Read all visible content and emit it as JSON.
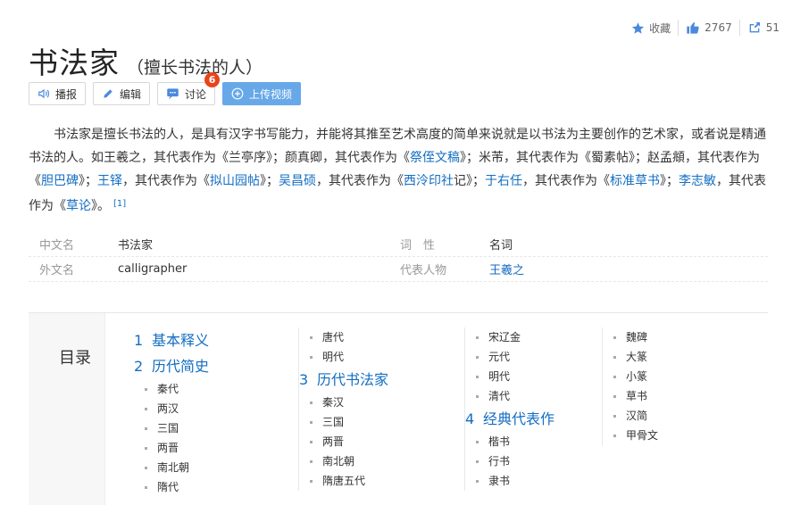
{
  "actions": {
    "favorite_label": "收藏",
    "like_count": "2767",
    "share_count": "51"
  },
  "title": {
    "main": "书法家",
    "sub": "（擅长书法的人）"
  },
  "toolbar": {
    "broadcast_label": "播报",
    "edit_label": "编辑",
    "discuss_label": "讨论",
    "discuss_badge": "6",
    "upload_label": "上传视频"
  },
  "summary": {
    "t1": "书法家是擅长书法的人，是具有汉字书写能力，并能将其推至艺术高度的简单来说就是以书法为主要创作的艺术家，或者说是精通书法的人。如王羲之，其代表作为《兰亭序》；颜真卿，其代表作为《",
    "a1": "祭侄文稿",
    "t2": "》；米芾，其代表作为《蜀素帖》；赵孟頫，其代表作为《",
    "a2": "胆巴碑",
    "t3": "》；",
    "a3": "王铎",
    "t4": "，其代表作为《",
    "a4": "拟山园帖",
    "t5": "》；",
    "a5": "吴昌硕",
    "t6": "，其代表作为《",
    "a6": "西泠印社",
    "t7": "记》；",
    "a7": "于右任",
    "t8": "，其代表作为《",
    "a8": "标准草书",
    "t9": "》；",
    "a9": "李志敏",
    "t10": "，其代表作为《",
    "a10": "草论",
    "t11": "》。",
    "ref": "[1]"
  },
  "infobox": {
    "rows": [
      {
        "k": "中文名",
        "v": "书法家",
        "k2": "词　性",
        "v2": "名词"
      },
      {
        "k": "外文名",
        "v": "calligrapher",
        "k2": "代表人物",
        "v2": "王羲之"
      }
    ]
  },
  "catalog": {
    "label": "目录",
    "col1": {
      "s1": {
        "num": "1",
        "label": "基本释义"
      },
      "s2": {
        "num": "2",
        "label": "历代简史"
      },
      "items": [
        "秦代",
        "两汉",
        "三国",
        "两晋",
        "南北朝",
        "隋代"
      ]
    },
    "col2": {
      "items_a": [
        "唐代",
        "明代"
      ],
      "s3": {
        "num": "3",
        "label": "历代书法家"
      },
      "items_b": [
        "秦汉",
        "三国",
        "两晋",
        "南北朝",
        "隋唐五代"
      ]
    },
    "col3": {
      "items_a": [
        "宋辽金",
        "元代",
        "明代",
        "清代"
      ],
      "s4": {
        "num": "4",
        "label": "经典代表作"
      },
      "items_b": [
        "楷书",
        "行书",
        "隶书"
      ]
    },
    "col4": {
      "items": [
        "魏碑",
        "大篆",
        "小篆",
        "草书",
        "汉简",
        "甲骨文"
      ]
    }
  },
  "colors": {
    "link": "#136ec2",
    "upload_bg": "#67a8e8",
    "badge": "#e8441b"
  }
}
